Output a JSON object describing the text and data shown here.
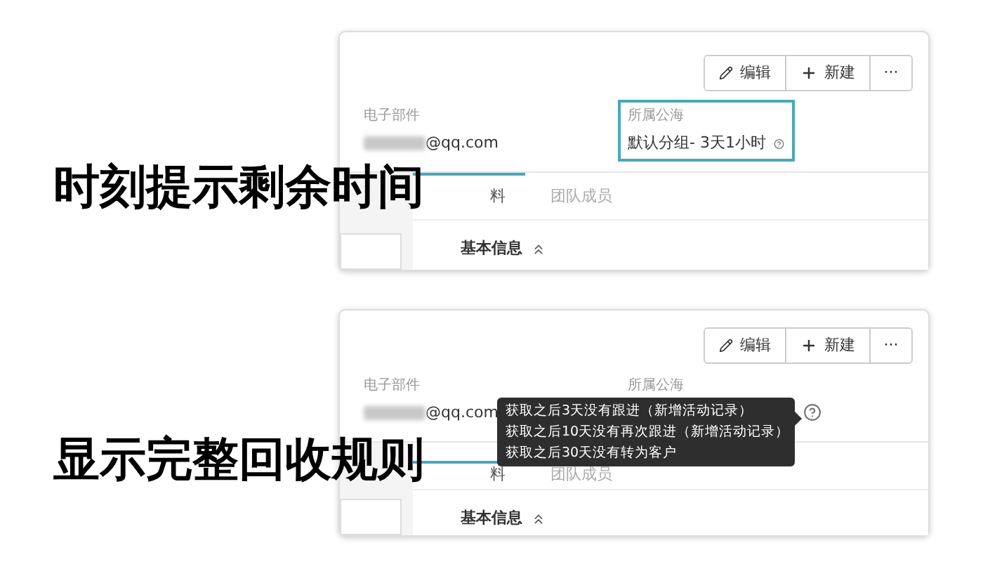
{
  "panels": [
    {
      "caption": "时刻提示剩余时间",
      "buttons": [
        {
          "kind": "edit",
          "label": "编辑"
        },
        {
          "kind": "new",
          "label": "新建"
        },
        {
          "kind": "more",
          "label": "···"
        }
      ],
      "email": {
        "label": "电子部件",
        "value": "@qq.com"
      },
      "pool": {
        "label": "所属公海",
        "value": "默认分组- 3天1小时",
        "highlighted": true
      },
      "tabs": [
        {
          "label": "料",
          "selected": true
        },
        {
          "label": "团队成员",
          "selected": false
        }
      ],
      "section": "基本信息"
    },
    {
      "caption": "显示完整回收规则",
      "buttons": [
        {
          "kind": "edit",
          "label": "编辑"
        },
        {
          "kind": "new",
          "label": "新建"
        },
        {
          "kind": "more",
          "label": "···"
        }
      ],
      "email": {
        "label": "电子部件",
        "value": "@qq.com"
      },
      "pool": {
        "label": "所属公海",
        "highlighted": false
      },
      "tooltip": [
        "获取之后3天没有跟进（新增活动记录）",
        "获取之后10天没有再次跟进（新增活动记录）",
        "获取之后30天没有转为客户"
      ],
      "tabs": [
        {
          "label": "料",
          "selected": true
        },
        {
          "label": "团队成员",
          "selected": false
        }
      ],
      "section": "基本信息"
    }
  ]
}
